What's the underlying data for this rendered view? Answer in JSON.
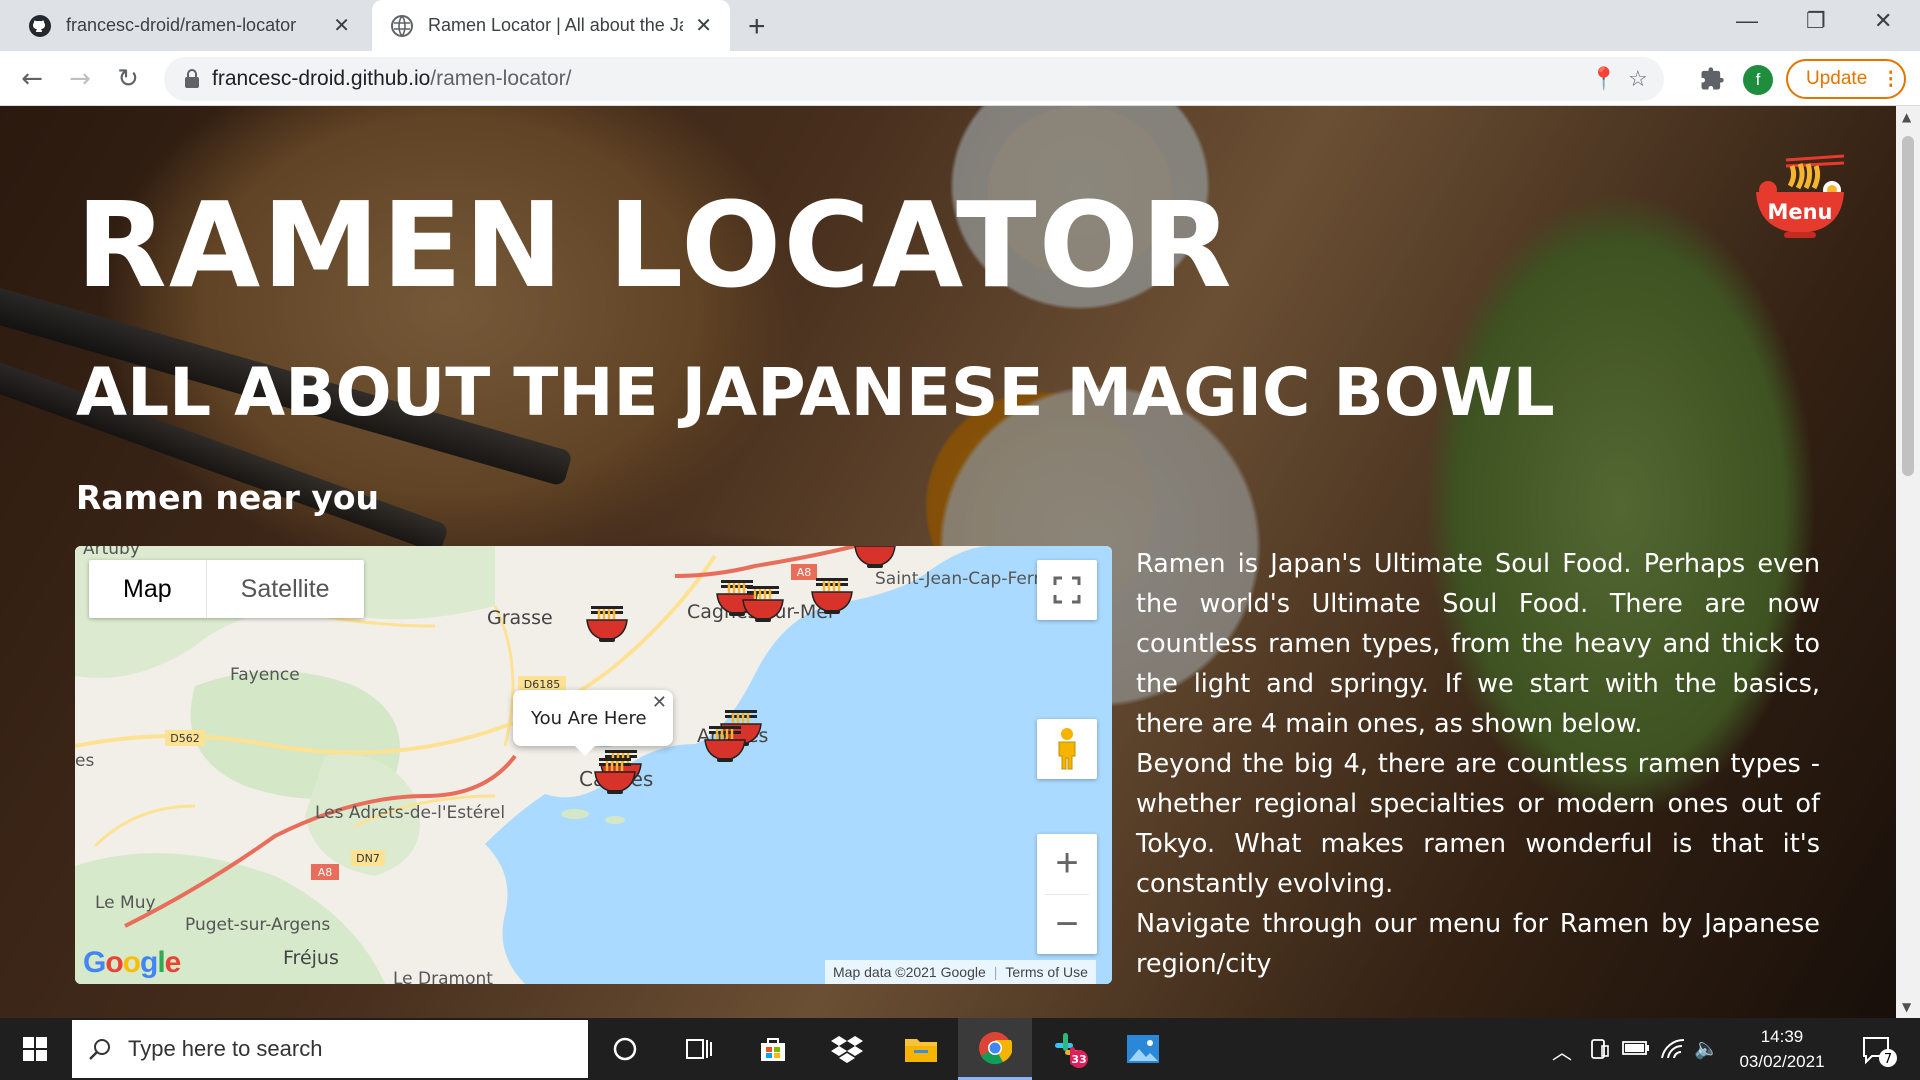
{
  "browser": {
    "tabs": [
      {
        "title": "francesc-droid/ramen-locator",
        "active": false
      },
      {
        "title": "Ramen Locator | All about the Japanese Magic Bowl",
        "active": true
      }
    ],
    "url_host": "francesc-droid.github.io",
    "url_path": "/ramen-locator/",
    "profile_initial": "f",
    "update_label": "Update"
  },
  "page": {
    "title": "RAMEN LOCATOR",
    "subtitle": "ALL ABOUT THE JAPANESE MAGIC BOWL",
    "section_heading": "Ramen near you",
    "menu_label": "Menu",
    "intro_paragraphs": [
      "Ramen is Japan's Ultimate Soul Food. Perhaps even the world's Ultimate Soul Food. There are now countless ramen types, from the heavy and thick to the light and springy. If we start with the basics, there are 4 main ones, as shown below.",
      "Beyond the big 4, there are countless ramen types - whether regional specialties or modern ones out of Tokyo. What makes ramen wonderful is that it's constantly evolving.",
      "Navigate through our menu for Ramen by Japanese region/city"
    ]
  },
  "map": {
    "type_controls": [
      "Map",
      "Satellite"
    ],
    "active_type": "Map",
    "info_window": "You Are Here",
    "places": {
      "artuby": "Artuby",
      "grasse": "Grasse",
      "fayence": "Fayence",
      "cagnes": "Cagnes-sur-Mer",
      "saint_jean": "Saint-Jean-Cap-Ferrat",
      "antibes": "Antibes",
      "cannes": "Cannes",
      "adrets": "Les Adrets-de-l'Estérel",
      "le_muy": "Le Muy",
      "puget": "Puget-sur-Argens",
      "frejus": "Fréjus",
      "le_dramont": "Le Dramont",
      "es": "es"
    },
    "road_labels": {
      "a8_top": "A8",
      "d6185": "D6185",
      "d562": "D562",
      "a8_bottom": "A8",
      "dn7": "DN7"
    },
    "attribution": "Map data ©2021 Google",
    "terms": "Terms of Use",
    "logo": "Google",
    "colors": {
      "water": "#aadaff",
      "land": "#f2efe9",
      "green": "#cfe6c2",
      "road_yellow": "#fde293",
      "highway_red": "#e86d5a"
    }
  },
  "taskbar": {
    "search_placeholder": "Type here to search",
    "time": "14:39",
    "date": "03/02/2021",
    "slack_badge": "33",
    "notification_count": "7"
  }
}
